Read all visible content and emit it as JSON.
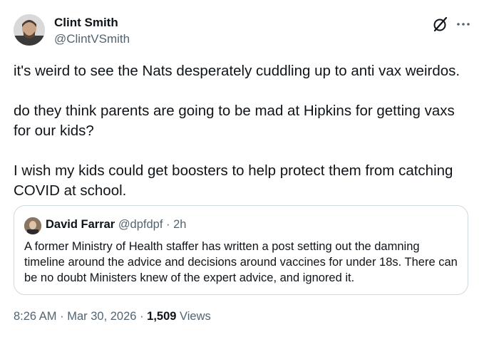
{
  "author": {
    "name": "Clint Smith",
    "handle": "@ClintVSmith"
  },
  "icons": {
    "grok": "grok-icon",
    "more": "more-icon"
  },
  "tweet": {
    "paragraphs": [
      "it's weird to see the Nats desperately cuddling up to anti vax weirdos.",
      "do they think parents are going to be mad at Hipkins for getting vaxs for our kids?",
      "I wish my kids could get boosters to help protect them from catching COVID at school."
    ]
  },
  "quoted": {
    "name": "David Farrar",
    "handle": "@dpfdpf",
    "separator": "·",
    "time": "2h",
    "text": "A former Ministry of Health staffer has written a post setting out the damning timeline around the advice and decisions around vaccines for under 18s. There can be no doubt Ministers knew of the expert advice, and ignored it."
  },
  "meta": {
    "time": "8:26 AM",
    "separator": "·",
    "date": "Mar 30, 2026",
    "views_count": "1,509",
    "views_label": "Views"
  },
  "colors": {
    "text": "#0f1419",
    "secondary": "#536471",
    "border": "#cfd9de"
  }
}
